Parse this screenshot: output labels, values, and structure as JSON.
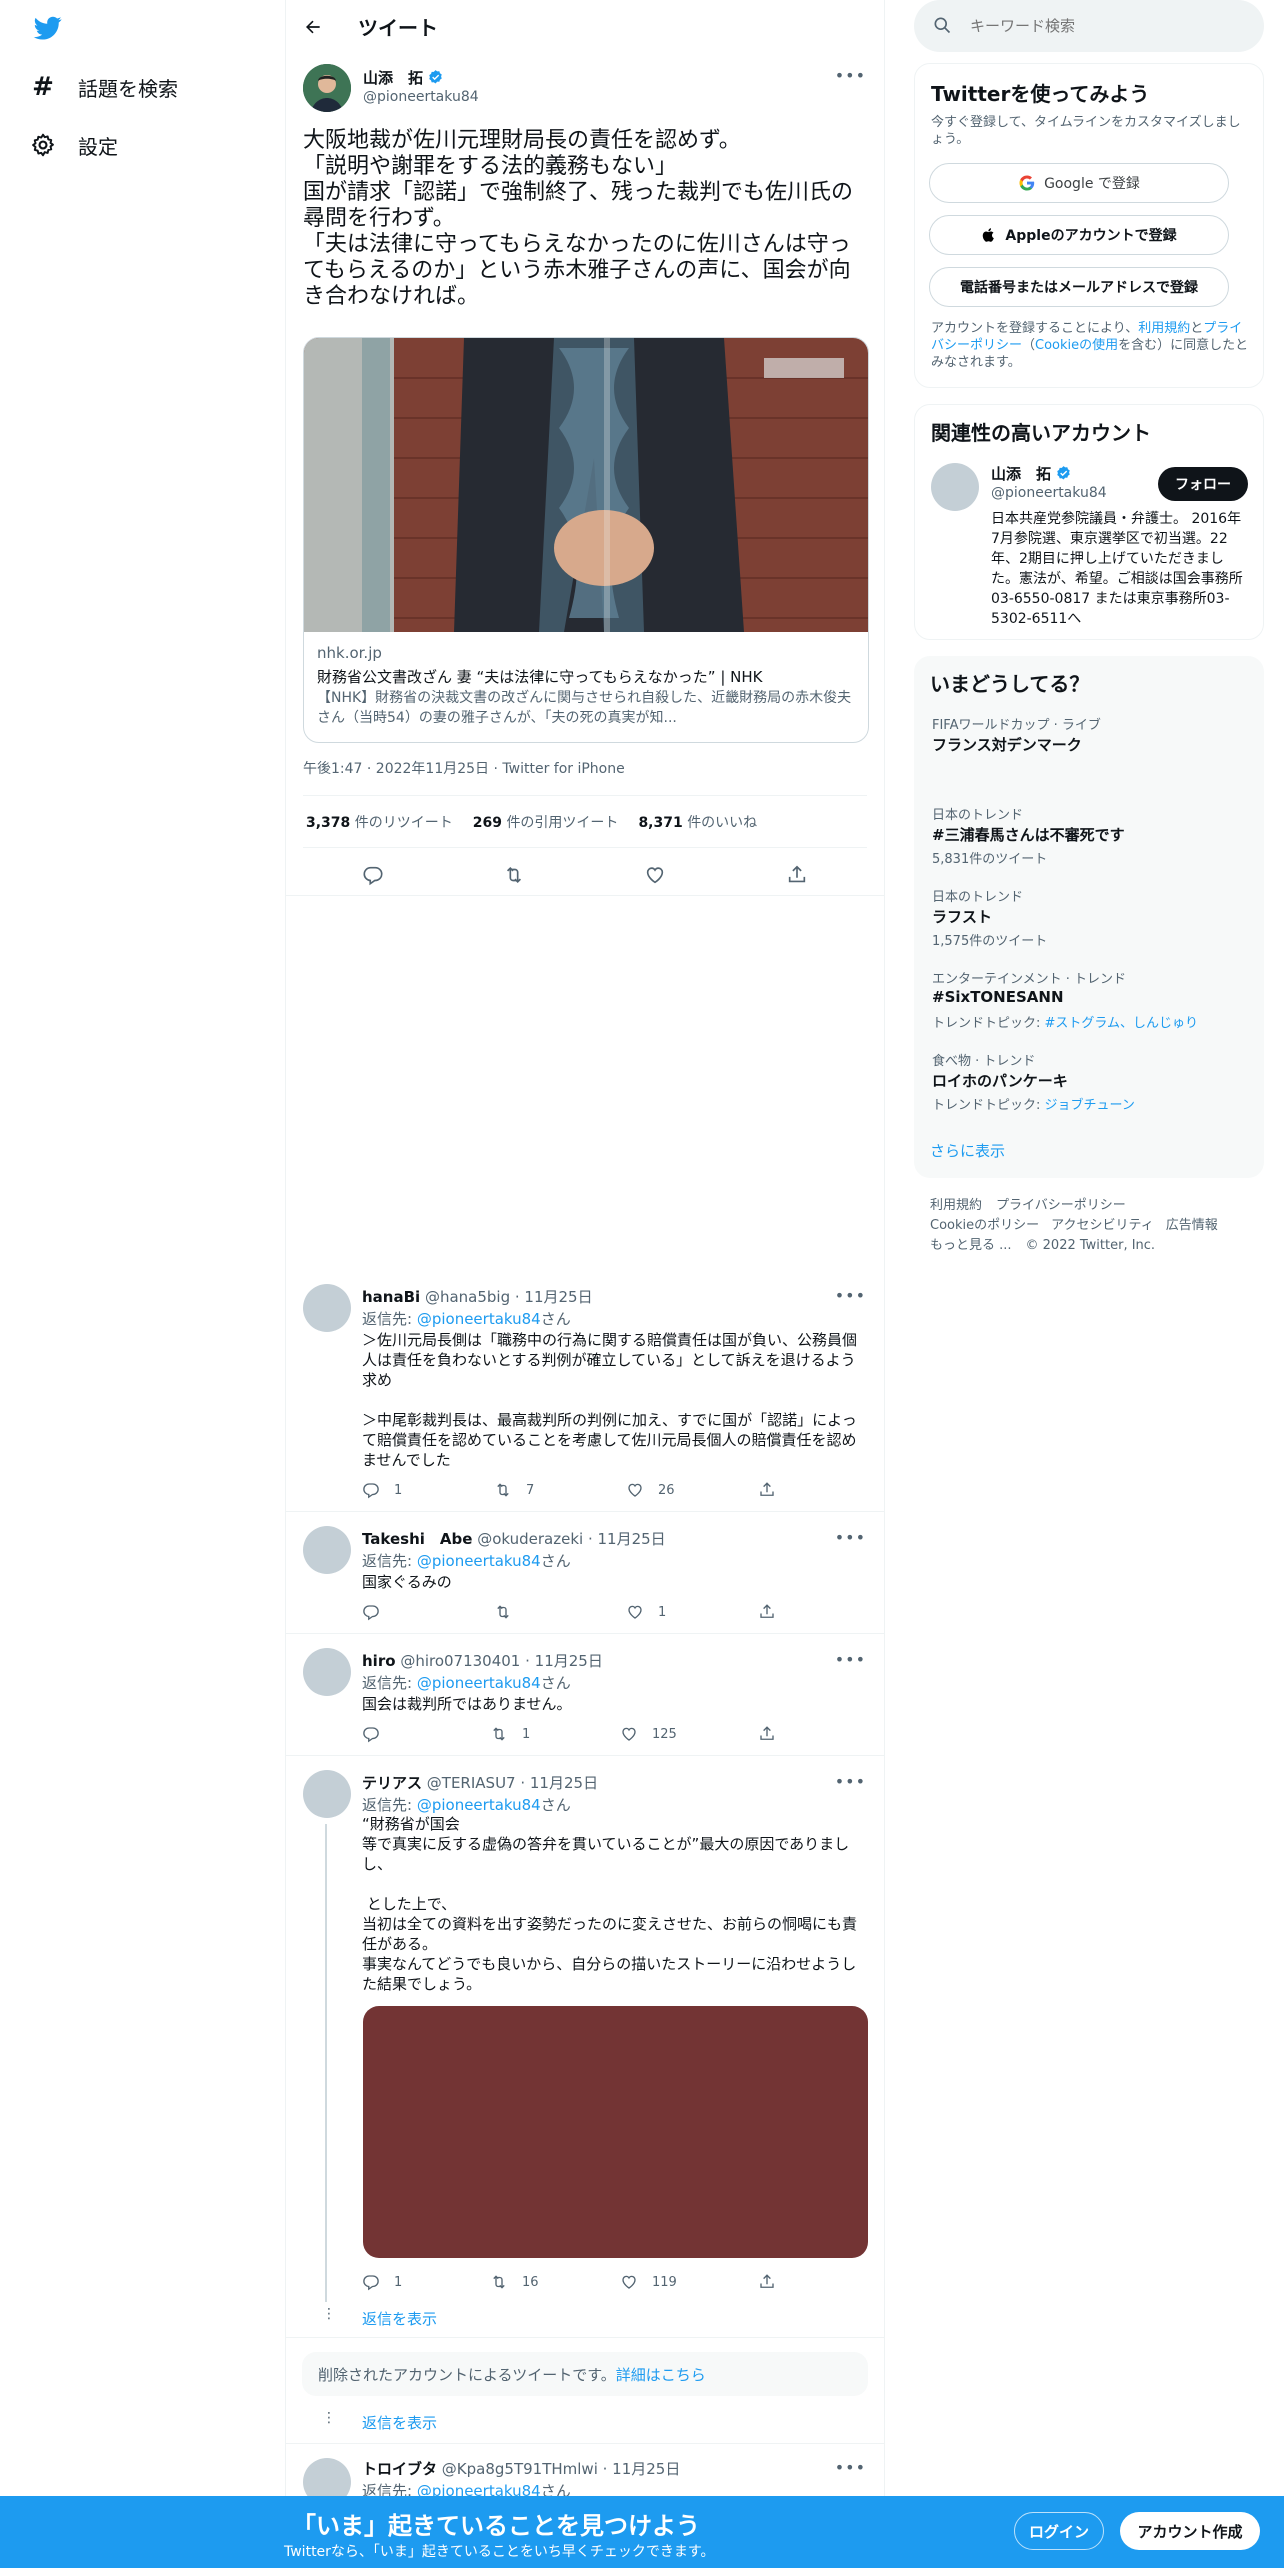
{
  "nav": {
    "explore_label": "話題を検索",
    "settings_label": "設定"
  },
  "header": {
    "title": "ツイート"
  },
  "tweet": {
    "author_name": "山添　拓",
    "author_handle": "@pioneertaku84",
    "text": "大阪地裁が佐川元理財局長の責任を認めず。\n「説明や謝罪をする法的義務もない」\n国が請求「認諾」で強制終了、残った裁判でも佐川氏の尋問を行わず。\n「夫は法律に守ってもらえなかったのに佐川さんは守ってもらえるのか」という赤木雅子さんの声に、国会が向き合わなければ。",
    "card_domain": "nhk.or.jp",
    "card_title": "財務省公文書改ざん 妻 “夫は法律に守ってもらえなかった” | NHK",
    "card_desc": "【NHK】財務省の決裁文書の改ざんに関与させられ自殺した、近畿財務局の赤木俊夫さん（当時54）の妻の雅子さんが、「夫の死の真実が知...",
    "meta": "午後1:47 · 2022年11月25日 · Twitter for iPhone",
    "retweets_count": "3,378",
    "retweets_label": "件のリツイート",
    "quotes_count": "269",
    "quotes_label": "件の引用ツイート",
    "likes_count": "8,371",
    "likes_label": "件のいいね"
  },
  "replies": [
    {
      "name": "hanaBi",
      "handle": "@hana5big · 11月25日",
      "reply_to_prefix": "返信先: ",
      "reply_to_handle": "@pioneertaku84",
      "reply_to_suffix": "さん",
      "text": "＞佐川元局長側は「職務中の行為に関する賠償責任は国が負い、公務員個人は責任を負わないとする判例が確立している」として訴えを退けるよう求め\n\n＞中尾彰裁判長は、最高裁判所の判例に加え、すでに国が「認諾」によって賠償責任を認めていることを考慮して佐川元局長個人の賠償責任を認めませんでした",
      "reply_count": "1",
      "retweet_count": "7",
      "like_count": "26"
    },
    {
      "name": "Takeshi　Abe",
      "handle": "@okuderazeki · 11月25日",
      "reply_to_prefix": "返信先: ",
      "reply_to_handle": "@pioneertaku84",
      "reply_to_suffix": "さん",
      "text": "国家ぐるみの",
      "reply_count": "",
      "retweet_count": "",
      "like_count": "1"
    },
    {
      "name": "hiro",
      "handle": "@hiro07130401 · 11月25日",
      "reply_to_prefix": "返信先: ",
      "reply_to_handle": "@pioneertaku84",
      "reply_to_suffix": "さん",
      "text": "国会は裁判所ではありません。",
      "reply_count": "",
      "retweet_count": "1",
      "like_count": "125"
    },
    {
      "name": "テリアス",
      "handle": "@TERIASU7 · 11月25日",
      "reply_to_prefix": "返信先: ",
      "reply_to_handle": "@pioneertaku84",
      "reply_to_suffix": "さん",
      "text": "“財務省が国会\n等で真実に反する虚偽の答弁を貫いていることが”最大の原因でありまし\nし、\n\n とした上で、\n当初は全ての資料を出す姿勢だったのに変えさせた、お前らの恫喝にも責任がある。\n事実なんてどうでも良いから、自分らの描いたストーリーに沿わせようした結果でしょう。",
      "reply_count": "1",
      "retweet_count": "16",
      "like_count": "119"
    },
    {
      "name": "トロイブタ",
      "handle": "@Kpa8g5T91THmlwi · 11月25日",
      "reply_to_prefix": "返信先: ",
      "reply_to_handle": "@pioneertaku84",
      "reply_to_suffix": "さん"
    }
  ],
  "show_replies_label": "返信を表示",
  "deleted_notice": "削除されたアカウントによるツイートです。",
  "deleted_link": "詳細はこちら",
  "search": {
    "placeholder": "キーワード検索"
  },
  "signup": {
    "title": "Twitterを使ってみよう",
    "subtitle": "今すぐ登録して、タイムラインをカスタマイズしましょう。",
    "google_label": "Google で登録",
    "apple_label": "Appleのアカウントで登録",
    "phone_label": "電話番号またはメールアドレスで登録",
    "legal_prefix": "アカウントを登録することにより、",
    "legal_link1": "利用規約",
    "legal_mid1": "と",
    "legal_link2": "プライバシーポリシー",
    "legal_mid2": "（",
    "legal_link3": "Cookieの使用",
    "legal_suffix": "を含む）に同意したとみなされます。"
  },
  "related": {
    "title": "関連性の高いアカウント",
    "name": "山添　拓",
    "handle": "@pioneertaku84",
    "follow_label": "フォロー",
    "bio": "日本共産党参院議員・弁護士。 2016年7月参院選、東京選挙区で初当選。22年、2期目に押し上げていただきました。憲法が、希望。ご相談は国会事務所03-6550-0817 または東京事務所03-5302-6511へ"
  },
  "trends": {
    "title": "いまどうしてる？",
    "items": [
      {
        "category": "FIFAワールドカップ · ライブ",
        "name": "フランス対デンマーク",
        "sub": "",
        "sub_link": ""
      },
      {
        "category": "日本のトレンド",
        "name": "#三浦春馬さんは不審死です",
        "sub": "5,831件のツイート",
        "sub_link": ""
      },
      {
        "category": "日本のトレンド",
        "name": "ラフスト",
        "sub": "1,575件のツイート",
        "sub_link": ""
      },
      {
        "category": "エンターテインメント · トレンド",
        "name": "#SixTONESANN",
        "sub": "トレンドトピック: ",
        "sub_link": "#ストグラム、しんじゅり"
      },
      {
        "category": "食べ物 · トレンド",
        "name": "ロイホのパンケーキ",
        "sub": "トレンドトピック: ",
        "sub_link": "ジョブチューン"
      }
    ],
    "show_more": "さらに表示"
  },
  "footer": {
    "terms": "利用規約",
    "privacy": "プライバシーポリシー",
    "cookie": "Cookieのポリシー",
    "accessibility": "アクセシビリティ",
    "ads": "広告情報",
    "more": "もっと見る ...",
    "copyright": "© 2022 Twitter, Inc."
  },
  "banner": {
    "title": "「いま」起きていることを見つけよう",
    "subtitle": "Twitterなら、「いま」起きていることをいち早くチェックできます。",
    "login_label": "ログイン",
    "signup_label": "アカウント作成"
  },
  "colors": {
    "accent": "#1d9bf0",
    "verified": "#1d9bf0",
    "reply_image": "#733434"
  }
}
